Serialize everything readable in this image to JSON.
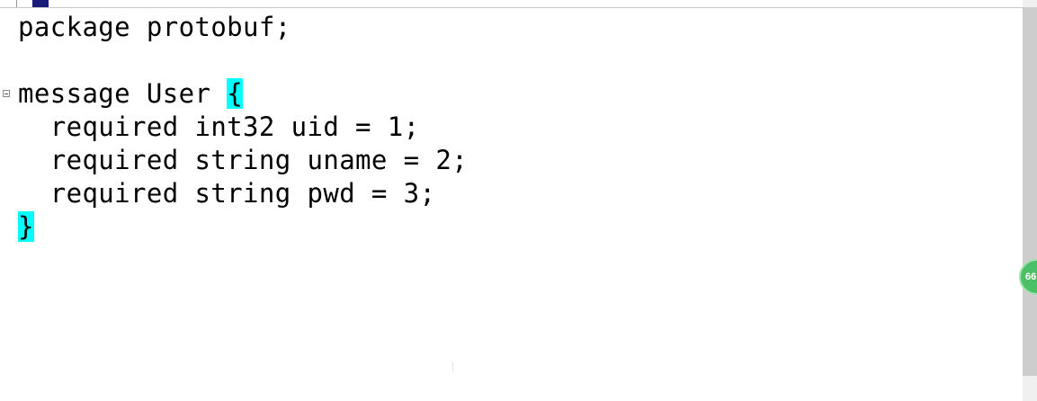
{
  "code_lines": [
    "package protobuf;",
    "",
    "message User ",
    "  required int32 uid = 1;",
    "  required string uname = 2;",
    "  required string pwd = 3;",
    ""
  ],
  "open_brace": "{",
  "close_brace": "}",
  "badge_text": "66",
  "colors": {
    "brace_highlight": "#00ffff",
    "badge": "#4cc067"
  },
  "icons": [
    "fold-collapse-icon"
  ]
}
